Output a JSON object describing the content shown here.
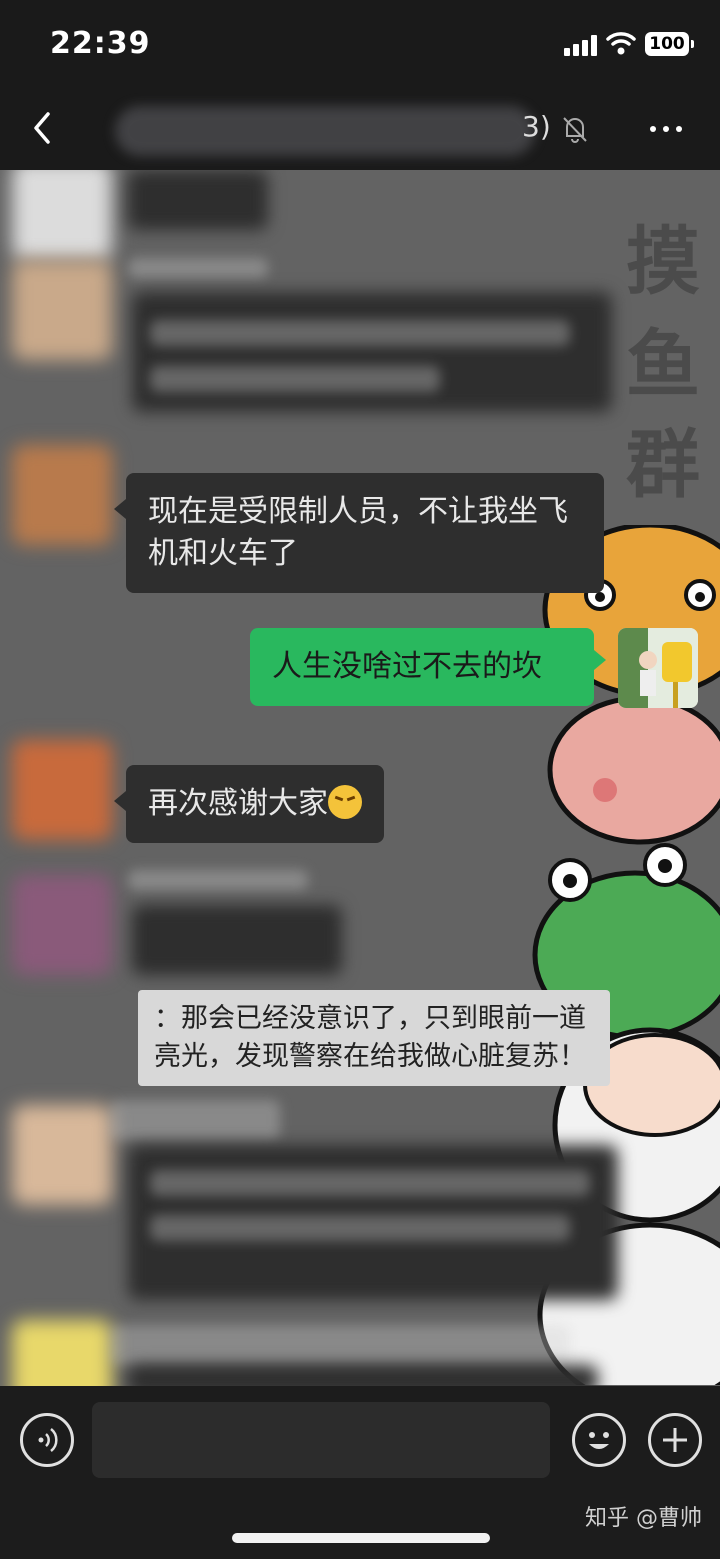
{
  "status_bar": {
    "time": "22:39",
    "battery": "100"
  },
  "nav": {
    "member_count_suffix": "3)",
    "title": ""
  },
  "chat_background": {
    "watermark_chars": [
      "摸",
      "鱼",
      "群"
    ]
  },
  "messages": [
    {
      "sender": "other",
      "text": "现在是受限制人员，不让我坐飞机和火车了"
    },
    {
      "sender": "self",
      "text": "人生没啥过不去的坎"
    },
    {
      "sender": "other",
      "text": "再次感谢大家"
    },
    {
      "sender": "quote",
      "text": "：那会已经没意识了，只到眼前一道亮光，发现警察在给我做心脏复苏！"
    }
  ],
  "input_bar": {
    "voice_icon": "voice-icon",
    "emoji_icon": "emoji-icon",
    "plus_icon": "plus-icon"
  },
  "watermark": {
    "text": "知乎 @曹帅"
  },
  "colors": {
    "self_bubble": "#29b85e",
    "other_bubble": "#2e2e2e",
    "chat_bg": "#636363"
  }
}
